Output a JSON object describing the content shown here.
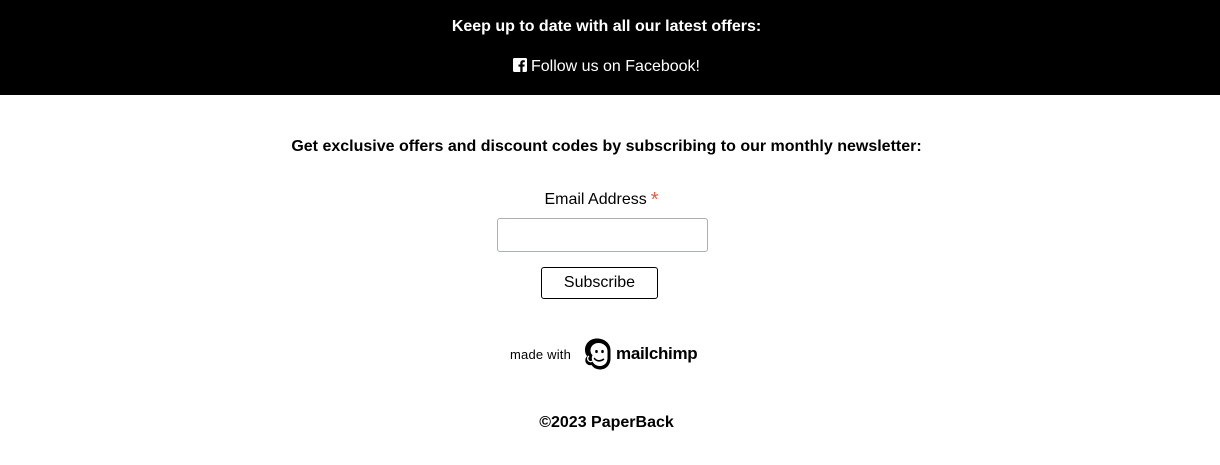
{
  "banner": {
    "heading": "Keep up to date with all our latest offers:",
    "facebook_icon": "facebook-square-icon",
    "facebook_link_text": "Follow us on Facebook!"
  },
  "newsletter": {
    "heading": "Get exclusive offers and discount codes by subscribing to our monthly newsletter:",
    "email_label": "Email Address",
    "required_marker": "*",
    "email_value": "",
    "email_placeholder": "",
    "subscribe_label": "Subscribe"
  },
  "mailchimp": {
    "made_with": "made with",
    "icon": "mailchimp-freddie-icon",
    "wordmark": "mailchimp"
  },
  "footer": {
    "copyright": "©2023 PaperBack"
  },
  "colors": {
    "banner_bg": "#000000",
    "required_star": "#e85c41"
  }
}
